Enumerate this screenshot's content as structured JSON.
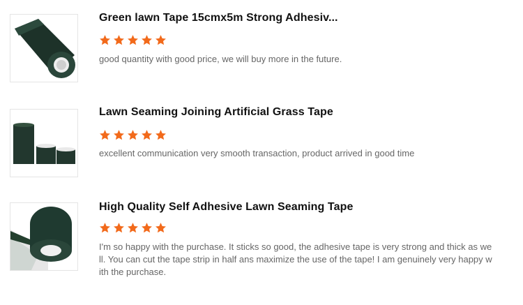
{
  "reviews": [
    {
      "title": "Green lawn Tape 15cmx5m Strong Adhesiv...",
      "rating": 5,
      "comment": "good quantity with good price, we will buy more in the future.",
      "image_icon": "tape-roll-image"
    },
    {
      "title": "Lawn Seaming Joining Artificial Grass Tape",
      "rating": 5,
      "comment": "excellent communication very smooth transaction, product arrived in good time",
      "image_icon": "tape-rolls-group-image"
    },
    {
      "title": "High Quality Self Adhesive Lawn Seaming Tape",
      "rating": 5,
      "comment": "I'm so happy with the purchase. It sticks so good, the adhesive tape is very strong and thick as we\nll. You can cut the tape strip in half ans maximize the use of the tape! I am genuinely very happy w\nith the purchase.",
      "image_icon": "tape-unrolled-image"
    }
  ],
  "colors": {
    "star": "#f26a1b",
    "title": "#111111",
    "comment": "#666666",
    "tape": "#1f3a30"
  }
}
